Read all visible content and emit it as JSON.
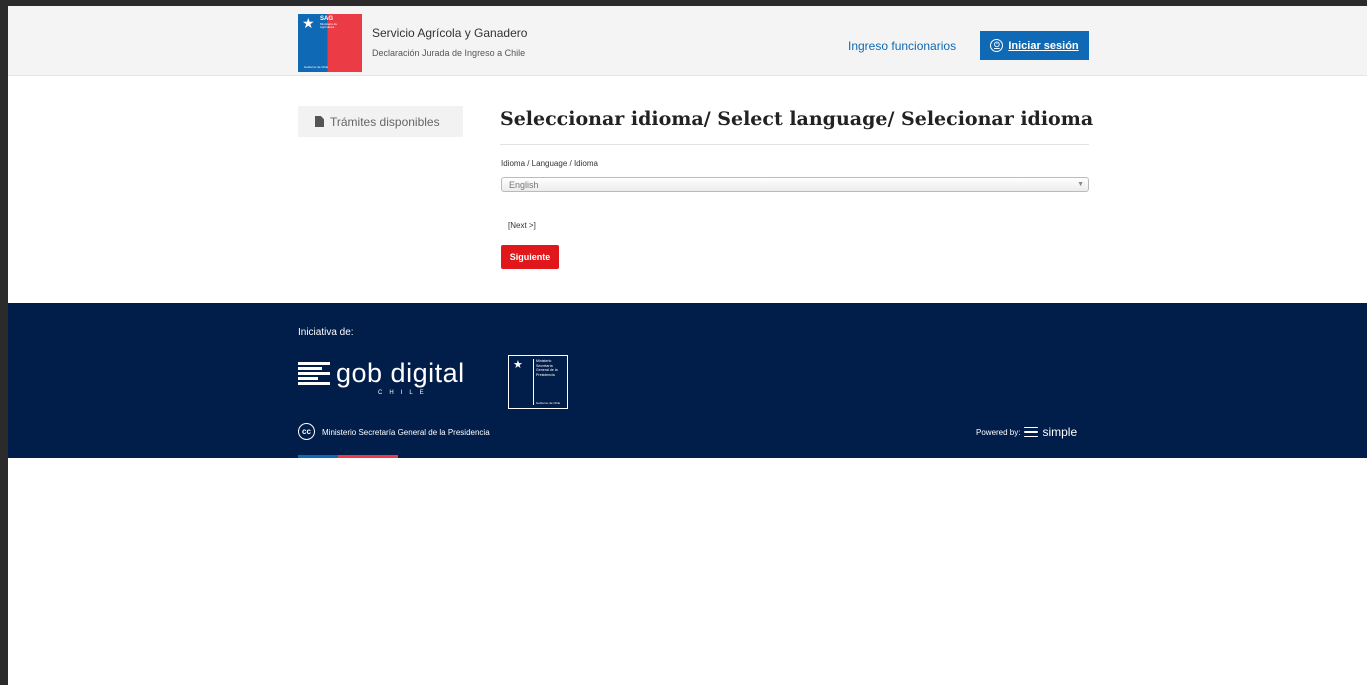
{
  "header": {
    "logo": {
      "acronym": "SAG",
      "subtitle": "Ministerio de Agricultura",
      "government": "Gobierno de Chile"
    },
    "title": "Servicio Agrícola y Ganadero",
    "subtitle": "Declaración Jurada de Ingreso a Chile",
    "staff_link": "Ingreso funcionarios",
    "login_label": "Iniciar sesión"
  },
  "sidebar": {
    "items": [
      {
        "label": "Trámites disponibles",
        "icon": "document-icon"
      }
    ]
  },
  "main": {
    "title": "Seleccionar idioma/ Select language/ Selecionar idioma",
    "field_label": "Idioma / Language / Idioma",
    "selected_language": "English",
    "next_link": "[Next >]",
    "submit_label": "Siguiente"
  },
  "footer": {
    "initiative_label": "Iniciativa de:",
    "gob_digital": "gob digital",
    "gob_digital_sub": "CHILE",
    "seal": {
      "lines": [
        "Ministerio",
        "Secretaría",
        "General de la",
        "Presidencia"
      ],
      "government": "Gobierno de Chile"
    },
    "ministry": "Ministerio Secretaría General de la Presidencia",
    "powered_by": "Powered by:",
    "powered_brand": "simple"
  },
  "colors": {
    "primary_blue": "#0f69b4",
    "primary_red": "#eb3c46",
    "button_red": "#e0171b",
    "footer_navy": "#011d49"
  }
}
